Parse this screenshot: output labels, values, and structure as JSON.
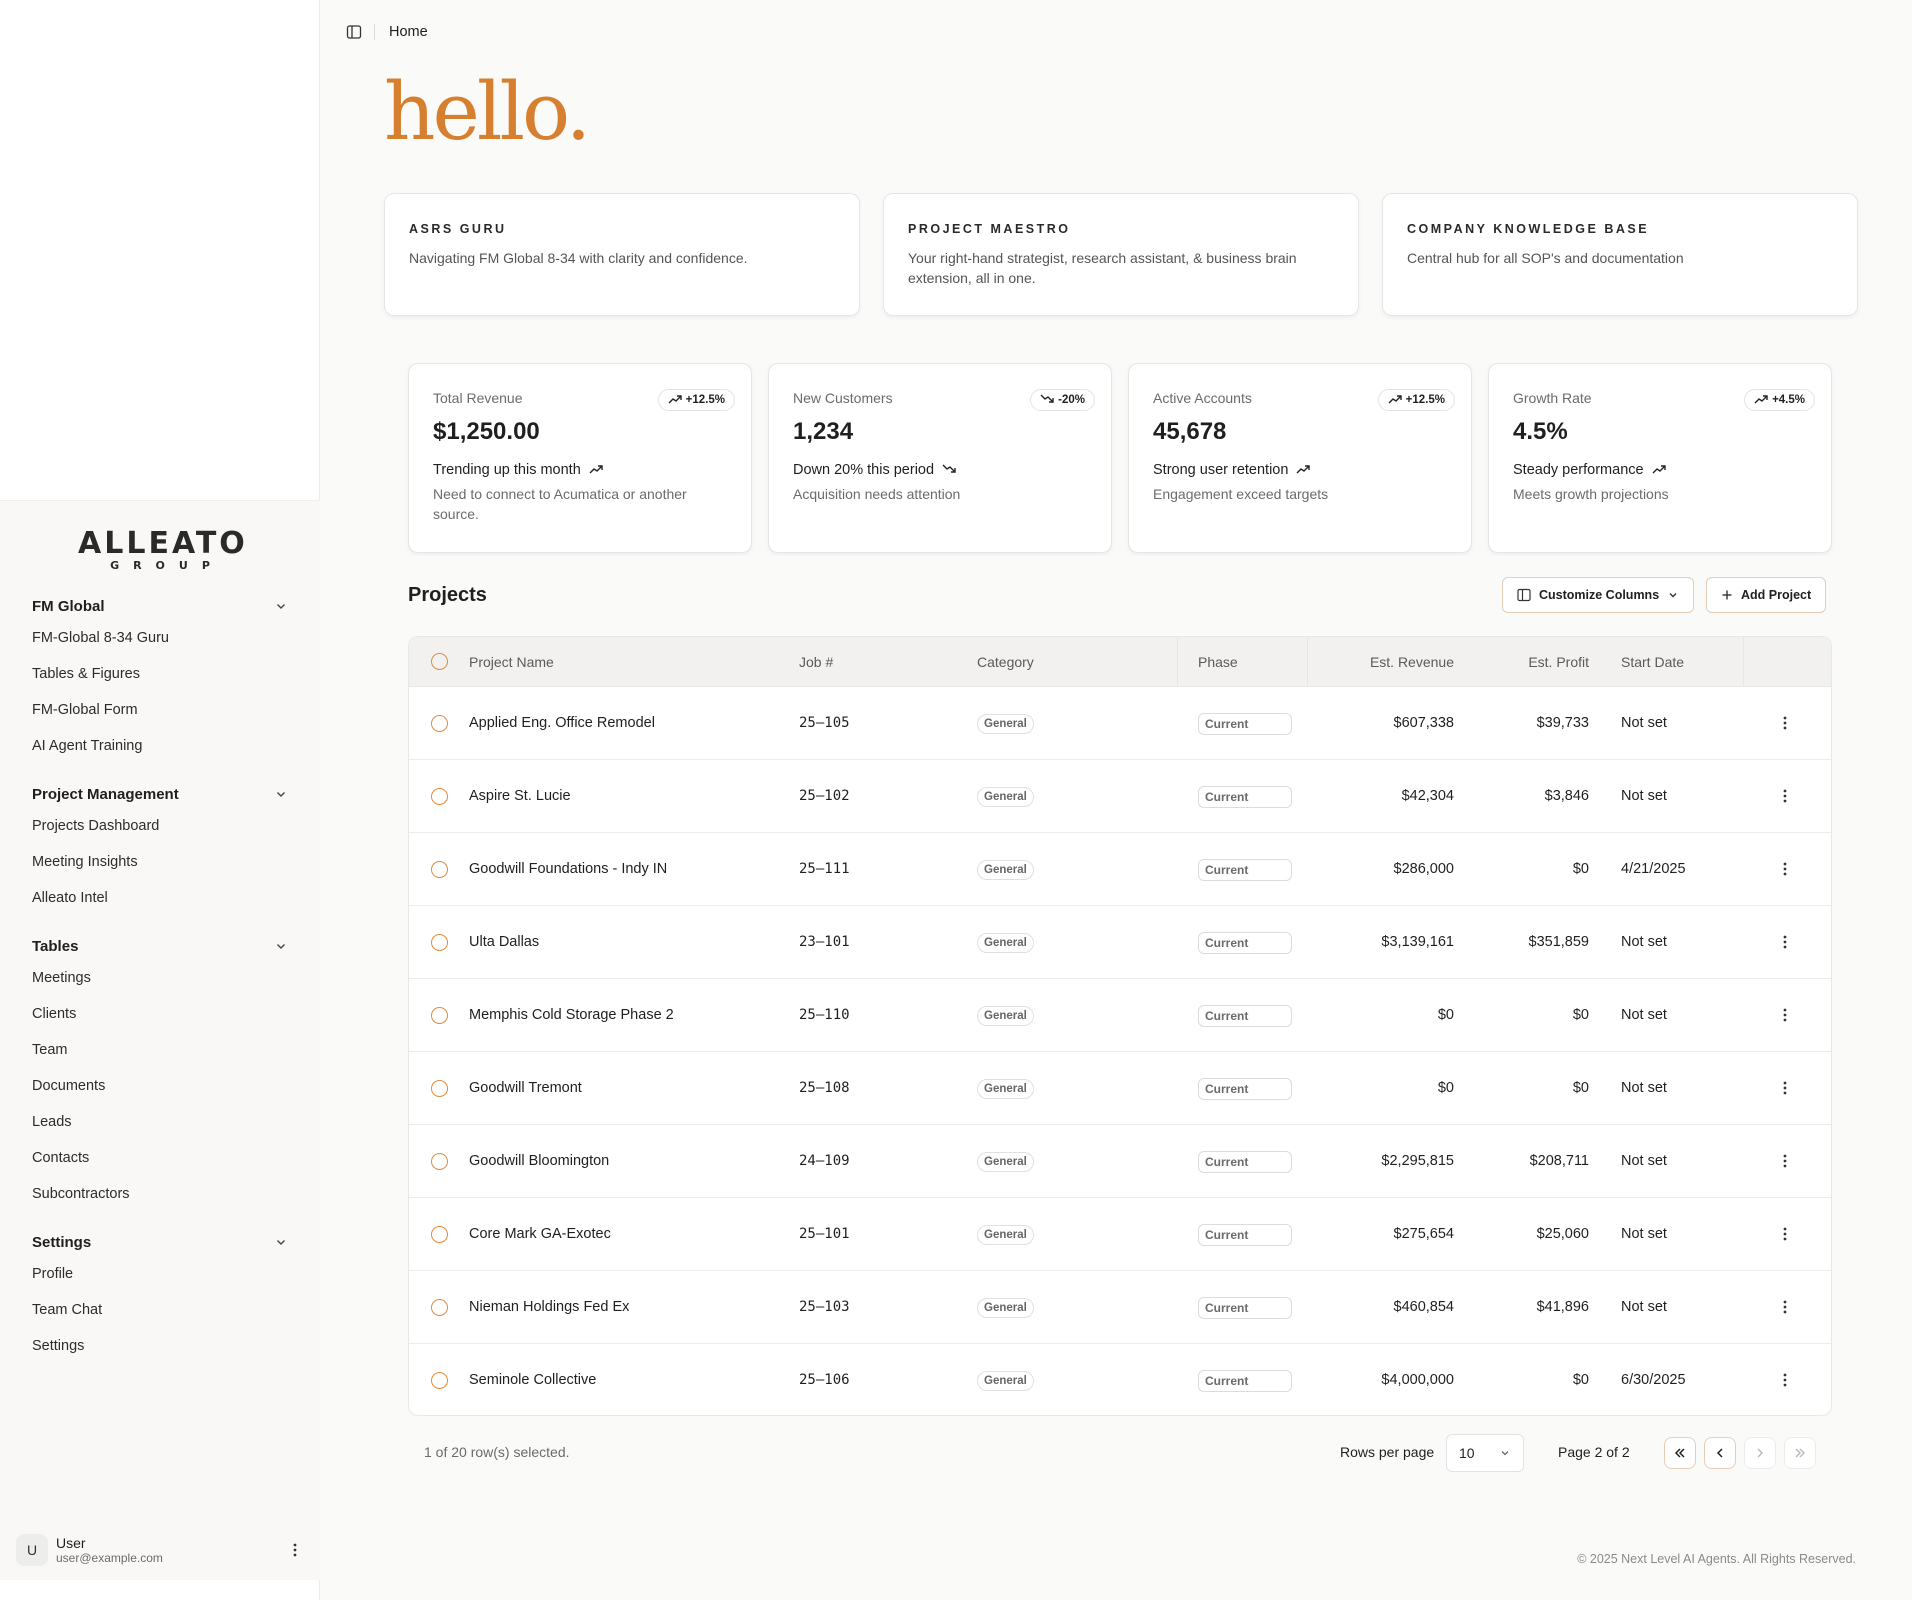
{
  "breadcrumb": {
    "current": "Home"
  },
  "greeting": "hello.",
  "brand": {
    "name": "ALLEATO",
    "sub": "GROUP"
  },
  "sidebar": {
    "groups": [
      {
        "title": "FM Global",
        "items": [
          "FM-Global 8-34 Guru",
          "Tables & Figures",
          "FM-Global Form",
          "AI Agent Training"
        ]
      },
      {
        "title": "Project Management",
        "items": [
          "Projects Dashboard",
          "Meeting Insights",
          "Alleato Intel"
        ]
      },
      {
        "title": "Tables",
        "items": [
          "Meetings",
          "Clients",
          "Team",
          "Documents",
          "Leads",
          "Contacts",
          "Subcontractors"
        ]
      },
      {
        "title": "Settings",
        "items": [
          "Profile",
          "Team Chat",
          "Settings"
        ]
      }
    ]
  },
  "user": {
    "initial": "U",
    "name": "User",
    "email": "user@example.com"
  },
  "agents": [
    {
      "title": "ASRS GURU",
      "desc": "Navigating FM Global 8-34 with clarity and confidence."
    },
    {
      "title": "PROJECT MAESTRO",
      "desc": "Your right-hand strategist, research assistant, & business brain extension, all in one."
    },
    {
      "title": "COMPANY KNOWLEDGE BASE",
      "desc": "Central hub for all SOP's and documentation"
    }
  ],
  "stats": [
    {
      "label": "Total Revenue",
      "badge": "+12.5%",
      "badge_dir": "up",
      "value": "$1,250.00",
      "trend": "Trending up this month",
      "trend_dir": "up",
      "sub": "Need to connect to Acumatica or another source."
    },
    {
      "label": "New Customers",
      "badge": "-20%",
      "badge_dir": "down",
      "value": "1,234",
      "trend": "Down 20% this period",
      "trend_dir": "down",
      "sub": "Acquisition needs attention"
    },
    {
      "label": "Active Accounts",
      "badge": "+12.5%",
      "badge_dir": "up",
      "value": "45,678",
      "trend": "Strong user retention",
      "trend_dir": "up",
      "sub": "Engagement exceed targets"
    },
    {
      "label": "Growth Rate",
      "badge": "+4.5%",
      "badge_dir": "up",
      "value": "4.5%",
      "trend": "Steady performance",
      "trend_dir": "up",
      "sub": "Meets growth projections"
    }
  ],
  "projects": {
    "title": "Projects",
    "customize_label": "Customize Columns",
    "add_label": "Add Project",
    "columns": [
      "Project Name",
      "Job #",
      "Category",
      "Phase",
      "Est. Revenue",
      "Est. Profit",
      "Start Date"
    ],
    "rows": [
      {
        "name": "Applied Eng. Office Remodel",
        "job": "25-105",
        "category": "General",
        "phase": "Current",
        "revenue": "$607,338",
        "profit": "$39,733",
        "start": "Not set"
      },
      {
        "name": "Aspire St. Lucie",
        "job": "25-102",
        "category": "General",
        "phase": "Current",
        "revenue": "$42,304",
        "profit": "$3,846",
        "start": "Not set"
      },
      {
        "name": "Goodwill Foundations - Indy IN",
        "job": "25-111",
        "category": "General",
        "phase": "Current",
        "revenue": "$286,000",
        "profit": "$0",
        "start": "4/21/2025"
      },
      {
        "name": "Ulta Dallas",
        "job": "23-101",
        "category": "General",
        "phase": "Current",
        "revenue": "$3,139,161",
        "profit": "$351,859",
        "start": "Not set"
      },
      {
        "name": "Memphis Cold Storage Phase 2",
        "job": "25-110",
        "category": "General",
        "phase": "Current",
        "revenue": "$0",
        "profit": "$0",
        "start": "Not set"
      },
      {
        "name": "Goodwill Tremont",
        "job": "25-108",
        "category": "General",
        "phase": "Current",
        "revenue": "$0",
        "profit": "$0",
        "start": "Not set"
      },
      {
        "name": "Goodwill Bloomington",
        "job": "24-109",
        "category": "General",
        "phase": "Current",
        "revenue": "$2,295,815",
        "profit": "$208,711",
        "start": "Not set"
      },
      {
        "name": "Core Mark GA-Exotec",
        "job": "25-101",
        "category": "General",
        "phase": "Current",
        "revenue": "$275,654",
        "profit": "$25,060",
        "start": "Not set"
      },
      {
        "name": "Nieman Holdings Fed Ex",
        "job": "25-103",
        "category": "General",
        "phase": "Current",
        "revenue": "$460,854",
        "profit": "$41,896",
        "start": "Not set"
      },
      {
        "name": "Seminole Collective",
        "job": "25-106",
        "category": "General",
        "phase": "Current",
        "revenue": "$4,000,000",
        "profit": "$0",
        "start": "6/30/2025"
      }
    ]
  },
  "pagination": {
    "selected_text": "1 of 20 row(s) selected.",
    "rows_per_page_label": "Rows per page",
    "rows_per_page_value": "10",
    "page_text": "Page 2 of 2"
  },
  "footer": {
    "copyright": "© 2025 Next Level AI Agents. All Rights Reserved."
  },
  "colors": {
    "accent": "#d67f2f",
    "radio": "#e18a3e"
  }
}
